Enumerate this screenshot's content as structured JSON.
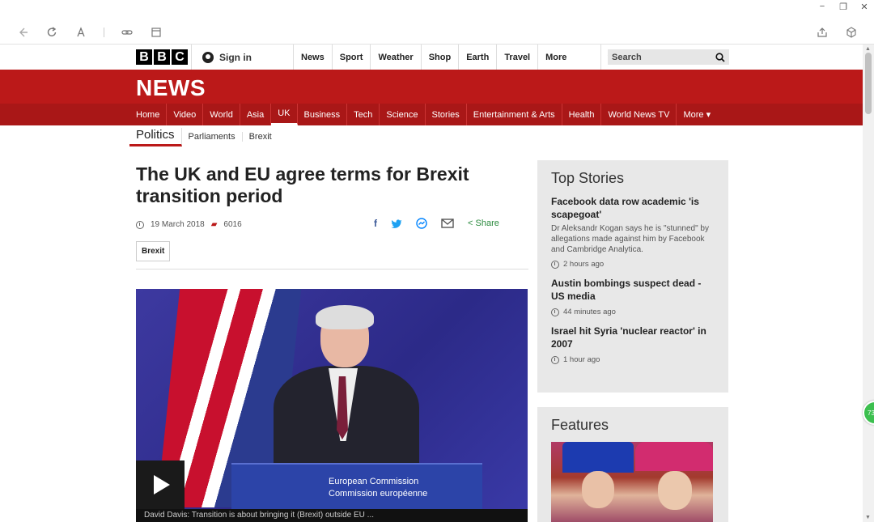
{
  "browser": {
    "controls": {
      "minimize": "−",
      "restore": "❐",
      "close": "✕"
    },
    "toolbar_icons": [
      "back-icon",
      "refresh-icon",
      "font-icon",
      "link-icon",
      "reader-icon"
    ],
    "right_icons": [
      "share-icon",
      "extension-icon"
    ],
    "badge": "73"
  },
  "bbc": {
    "logo": [
      "B",
      "B",
      "C"
    ],
    "signin": "Sign in",
    "nav": [
      "News",
      "Sport",
      "Weather",
      "Shop",
      "Earth",
      "Travel"
    ],
    "more": "More",
    "search_placeholder": "Search"
  },
  "news": {
    "title": "NEWS",
    "nav": [
      "Home",
      "Video",
      "World",
      "Asia",
      "UK",
      "Business",
      "Tech",
      "Science",
      "Stories",
      "Entertainment & Arts",
      "Health",
      "World News TV"
    ],
    "more": "More ▾",
    "active": "UK",
    "accent": "#bb1919"
  },
  "subnav": {
    "current": "Politics",
    "items": [
      "Parliaments",
      "Brexit"
    ]
  },
  "article": {
    "headline": "The UK and EU agree terms for Brexit transition period",
    "date": "19 March 2018",
    "comments": "6016",
    "share": "Share",
    "tag": "Brexit",
    "podium_line1": "European Commission",
    "podium_line2": "Commission européenne",
    "video_caption": "David Davis: Transition is about bringing it (Brexit) outside EU ..."
  },
  "top_stories": {
    "title": "Top Stories",
    "items": [
      {
        "title": "Facebook data row academic 'is scapegoat'",
        "summary": "Dr Aleksandr Kogan says he is \"stunned\" by allegations made against him by Facebook and Cambridge Analytica.",
        "time": "2 hours ago"
      },
      {
        "title": "Austin bombings suspect dead - US media",
        "summary": "",
        "time": "44 minutes ago"
      },
      {
        "title": "Israel hit Syria 'nuclear reactor' in 2007",
        "summary": "",
        "time": "1 hour ago"
      }
    ]
  },
  "features": {
    "title": "Features"
  }
}
